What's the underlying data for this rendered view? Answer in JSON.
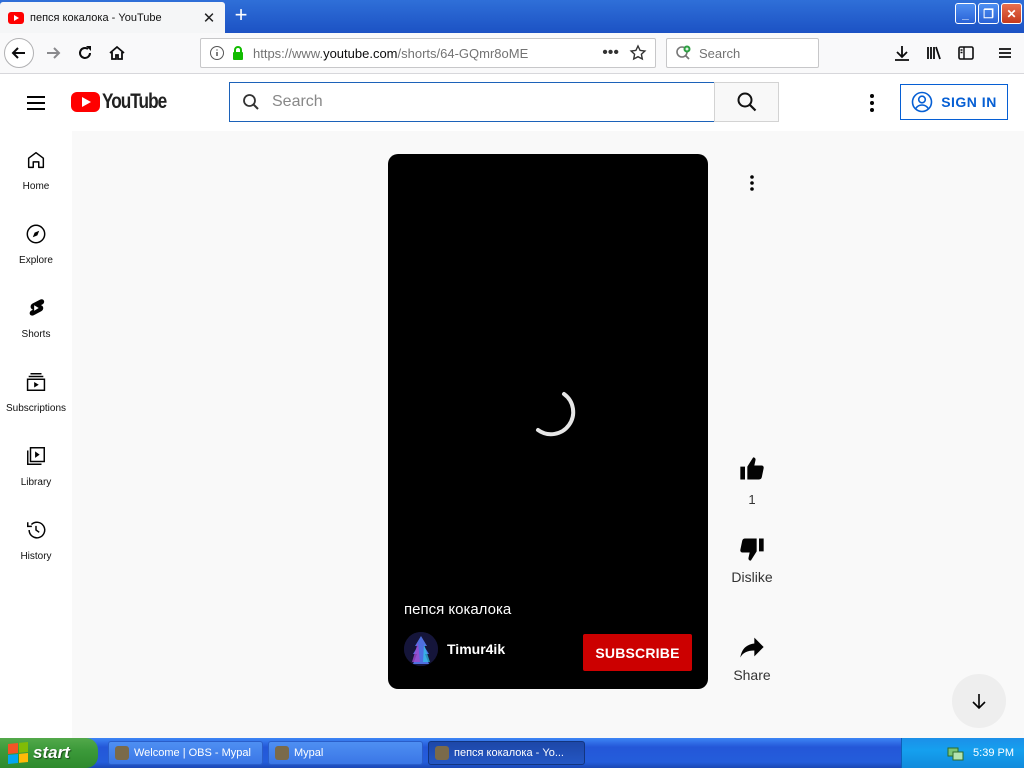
{
  "browser": {
    "tab_title": "пепся кокалока - YouTube",
    "url_prefix": "https://www.",
    "url_domain": "youtube.com",
    "url_path": "/shorts/64-GQmr8oME",
    "search_placeholder": "Search"
  },
  "youtube": {
    "logo_text": "YouTube",
    "search_placeholder": "Search",
    "sign_in_label": "SIGN IN",
    "guide": [
      {
        "label": "Home",
        "icon": "home-icon"
      },
      {
        "label": "Explore",
        "icon": "compass-icon"
      },
      {
        "label": "Shorts",
        "icon": "shorts-icon"
      },
      {
        "label": "Subscriptions",
        "icon": "subscriptions-icon"
      },
      {
        "label": "Library",
        "icon": "library-icon"
      },
      {
        "label": "History",
        "icon": "history-icon"
      }
    ],
    "short": {
      "title": "пепся кокалока",
      "channel": "Timur4ik",
      "subscribe_label": "SUBSCRIBE",
      "like_count": "1",
      "dislike_label": "Dislike",
      "share_label": "Share"
    },
    "colors": {
      "accent": "#ff0000",
      "link": "#065fd4",
      "subscribe": "#cc0000"
    }
  },
  "taskbar": {
    "start_label": "start",
    "buttons": [
      {
        "label": "Welcome | OBS - Mypal",
        "active": false
      },
      {
        "label": "Mypal",
        "active": false
      },
      {
        "label": "пепся кокалока - Yo...",
        "active": true
      }
    ],
    "clock": "5:39 PM"
  }
}
